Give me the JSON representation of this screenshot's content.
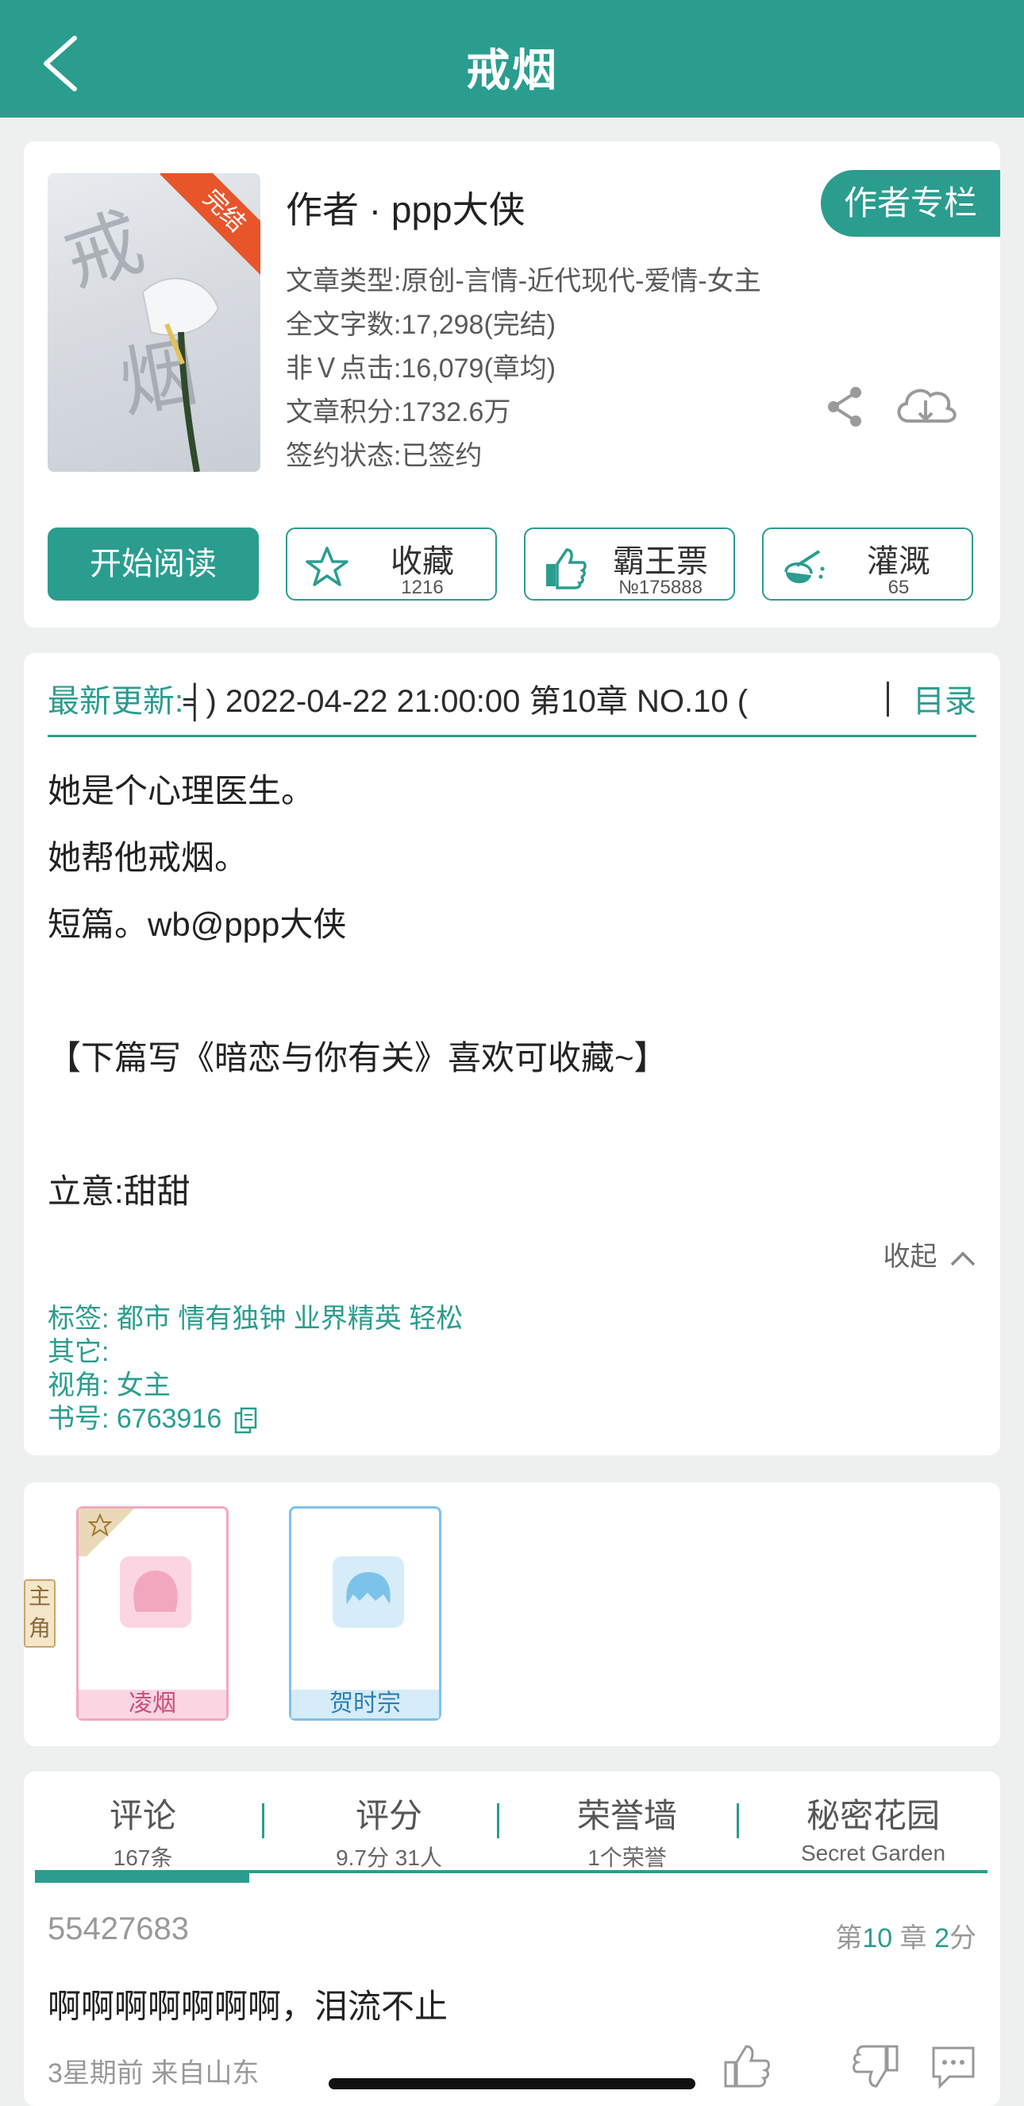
{
  "header": {
    "title": "戒烟",
    "back_icon": "chevron-left-icon"
  },
  "book": {
    "cover_badge": "完结",
    "author": "作者 · ppp大侠",
    "author_column_button": "作者专栏",
    "meta": [
      "文章类型:原创-言情-近代现代-爱情-女主",
      "全文字数:17,298(完结)",
      "非Ｖ点击:16,079(章均)",
      "文章积分:1732.6万",
      "签约状态:已签约"
    ],
    "share_icon": "share-icon",
    "download_icon": "cloud-download-icon",
    "actions": {
      "read": "开始阅读",
      "collect": {
        "label": "收藏",
        "count": "1216"
      },
      "ticket": {
        "label": "霸王票",
        "count": "№175888"
      },
      "water": {
        "label": "灌溉",
        "count": "65"
      }
    }
  },
  "description": {
    "latest_label": "最新更新:",
    "latest_text": "╡) 2022-04-22 21:00:00  第10章 NO.10 (",
    "toc": "目录",
    "paragraphs": [
      "她是个心理医生。",
      "她帮他戒烟。",
      "短篇。wb@ppp大侠",
      "【下篇写《暗恋与你有关》喜欢可收藏~】",
      "立意:甜甜"
    ],
    "collapse": "收起",
    "tags_line": "标签: 都市     情有独钟   业界精英   轻松",
    "other_line": "其它:",
    "pov_line": "视角: 女主",
    "book_id_line": "书号: 6763916"
  },
  "roles": {
    "side_label": "主角",
    "items": [
      {
        "name": "凌烟",
        "color": "#f3a7bf"
      },
      {
        "name": "贺时宗",
        "color": "#7cc3ea"
      }
    ]
  },
  "comments": {
    "tabs": [
      {
        "title": "评论",
        "sub": "167条"
      },
      {
        "title": "评分",
        "sub": "9.7分 31人"
      },
      {
        "title": "荣誉墙",
        "sub": "1个荣誉"
      },
      {
        "title": "秘密花园",
        "sub": "Secret Garden"
      }
    ],
    "item": {
      "user": "55427683",
      "chapter_prefix": "第",
      "chapter_num": "10",
      "chapter_mid": "章",
      "score": "2",
      "score_suffix": "分",
      "text": "啊啊啊啊啊啊啊，泪流不止",
      "meta": "3星期前  来自山东"
    }
  },
  "colors": {
    "accent": "#2a9d8f",
    "badge": "#e8552a"
  }
}
